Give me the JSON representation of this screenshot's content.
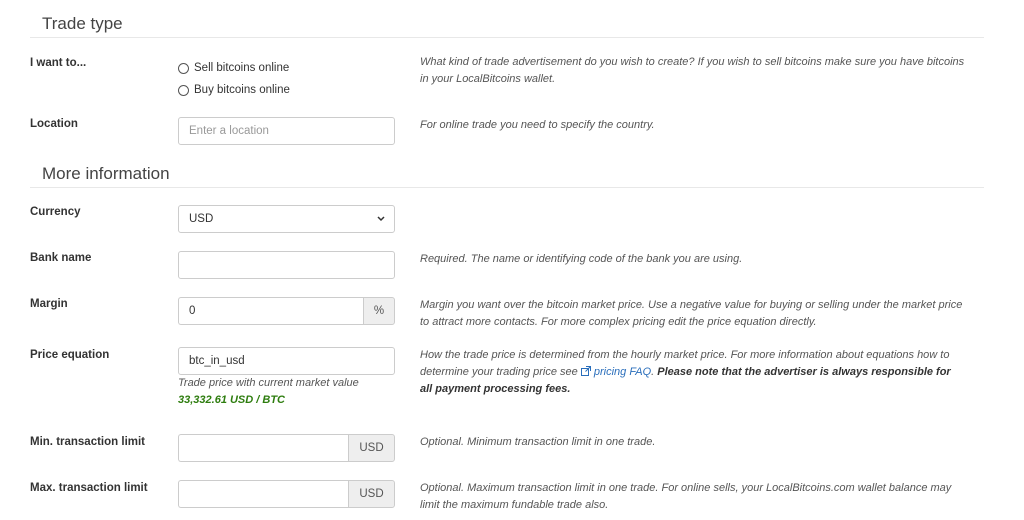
{
  "sections": {
    "trade_type": "Trade type",
    "more_info": "More information"
  },
  "i_want_to": {
    "label": "I want to...",
    "options": [
      "Sell bitcoins online",
      "Buy bitcoins online"
    ],
    "help": "What kind of trade advertisement do you wish to create? If you wish to sell bitcoins make sure you have bitcoins in your LocalBitcoins wallet."
  },
  "location": {
    "label": "Location",
    "placeholder": "Enter a location",
    "help": "For online trade you need to specify the country."
  },
  "currency": {
    "label": "Currency",
    "value": "USD"
  },
  "bank_name": {
    "label": "Bank name",
    "value": "",
    "help": "Required. The name or identifying code of the bank you are using."
  },
  "margin": {
    "label": "Margin",
    "value": "0",
    "addon": "%",
    "help": "Margin you want over the bitcoin market price. Use a negative value for buying or selling under the market price to attract more contacts. For more complex pricing edit the price equation directly."
  },
  "price_equation": {
    "label": "Price equation",
    "value": "btc_in_usd",
    "note": "Trade price with current market value",
    "price": "33,332.61 USD / BTC",
    "help_intro": "How the trade price is determined from the hourly market price. For more information about equations how to determine your trading price see",
    "help_link": "pricing FAQ",
    "help_bold": "Please note that the advertiser is always responsible for all payment processing fees."
  },
  "min_limit": {
    "label": "Min. transaction limit",
    "value": "",
    "addon": "USD",
    "help": "Optional. Minimum transaction limit in one trade."
  },
  "max_limit": {
    "label": "Max. transaction limit",
    "value": "",
    "addon": "USD",
    "help": "Optional. Maximum transaction limit in one trade. For online sells, your LocalBitcoins.com wallet balance may limit the maximum fundable trade also."
  }
}
